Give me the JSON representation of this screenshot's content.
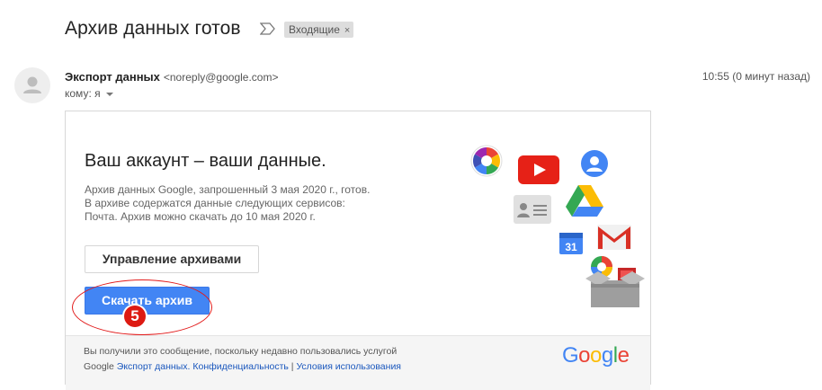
{
  "email": {
    "subject": "Архив данных готов",
    "label_chip": "Входящие",
    "label_remove": "×",
    "sender_name": "Экспорт данных",
    "sender_email": "<noreply@google.com>",
    "to_line": "кому: я",
    "time": "10:55 (0 минут назад)"
  },
  "card": {
    "title": "Ваш аккаунт – ваши данные.",
    "body_line1": "Архив данных Google, запрошенный 3 мая 2020 г., готов.",
    "body_line2": "В архиве содержатся данные следующих сервисов:",
    "body_line3": "Почта. Архив можно скачать до 10 мая 2020 г.",
    "manage_button": "Управление архивами",
    "download_button": "Скачать архив",
    "step_number": "5",
    "calendar_day": "31"
  },
  "footer": {
    "text_prefix": "Вы получили это сообщение, поскольку недавно пользовались услугой Google",
    "link_export": "Экспорт данных.",
    "link_privacy": "Конфиденциальность",
    "separator": "|",
    "link_terms": "Условия использования",
    "logo_letters": [
      "G",
      "o",
      "o",
      "g",
      "l",
      "e"
    ]
  },
  "colors": {
    "accent_blue": "#4285f4",
    "highlight_red": "#e21b1b",
    "google_blue": "#4285f4",
    "google_red": "#ea4335",
    "google_yellow": "#fbbc05",
    "google_green": "#34a853"
  },
  "icons": [
    "importance-marker-icon",
    "avatar-person-icon",
    "dropdown-caret-icon",
    "photos-icon",
    "youtube-icon",
    "contacts-icon",
    "profile-icon",
    "drive-icon",
    "calendar-icon",
    "gmail-icon",
    "hangouts-icon",
    "box-icon"
  ]
}
